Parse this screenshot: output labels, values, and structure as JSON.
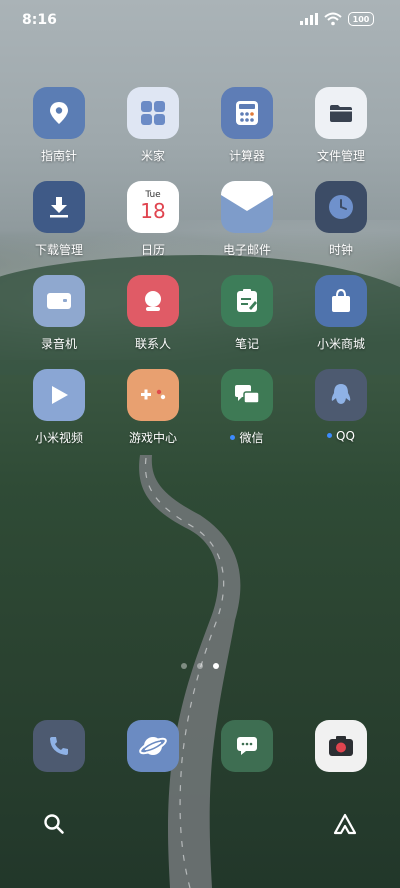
{
  "status_bar": {
    "time": "8:16",
    "battery": "100"
  },
  "apps": [
    {
      "label": "指南针",
      "color": "#5b7db4"
    },
    {
      "label": "米家",
      "color": "#dfe6f3"
    },
    {
      "label": "计算器",
      "color": "#5e7db6"
    },
    {
      "label": "文件管理",
      "color": "#eef1f5"
    },
    {
      "label": "下载管理",
      "color": "#3f5a87"
    },
    {
      "label": "日历",
      "color": "#ffffff",
      "weekday": "Tue",
      "day": "18"
    },
    {
      "label": "电子邮件",
      "color": "#7e9cca"
    },
    {
      "label": "时钟",
      "color": "#3c4c66"
    },
    {
      "label": "录音机",
      "color": "#8fa8cf"
    },
    {
      "label": "联系人",
      "color": "#e05b66"
    },
    {
      "label": "笔记",
      "color": "#3d7d59"
    },
    {
      "label": "小米商城",
      "color": "#4f73ad"
    },
    {
      "label": "小米视频",
      "color": "#8aa6d4"
    },
    {
      "label": "游戏中心",
      "color": "#e8a070"
    },
    {
      "label": "微信",
      "color": "#3e7a55"
    },
    {
      "label": "QQ",
      "color": "#4d5a70"
    }
  ],
  "page_indicator": {
    "total": 3,
    "current": 3
  },
  "dock": [
    {
      "name": "phone",
      "color": "#4d5a70"
    },
    {
      "name": "browser",
      "color": "#6b8bc2"
    },
    {
      "name": "messages",
      "color": "#3e6e52"
    },
    {
      "name": "camera",
      "color": "#f1f1f1"
    }
  ]
}
